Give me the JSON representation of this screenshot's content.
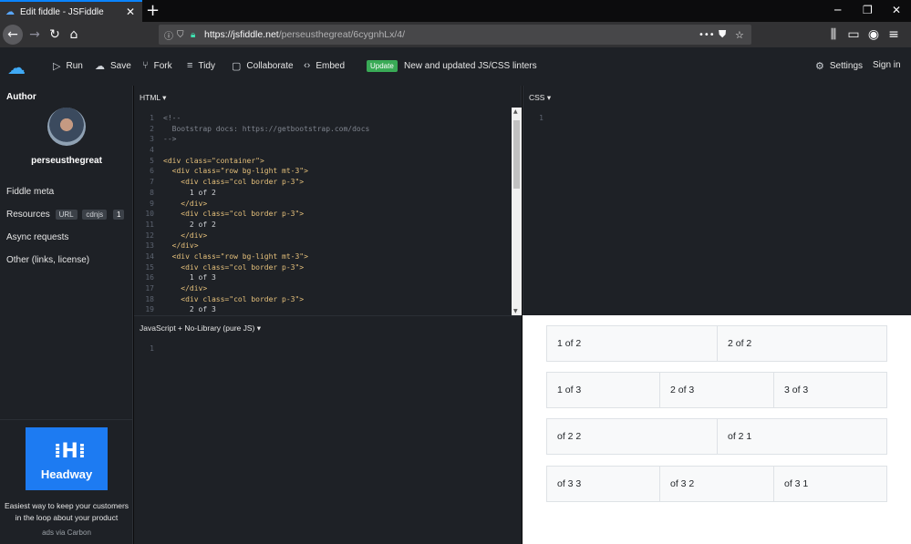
{
  "browser": {
    "tab_title": "Edit fiddle - JSFiddle",
    "url_host": "https://jsfiddle.net",
    "url_path": "/perseusthegreat/6cygnhLx/4/"
  },
  "toolbar": {
    "run": "Run",
    "save": "Save",
    "fork": "Fork",
    "tidy": "Tidy",
    "collaborate": "Collaborate",
    "embed": "Embed",
    "update_badge": "Update",
    "update_text": "New and updated JS/CSS linters",
    "settings": "Settings",
    "signin": "Sign in"
  },
  "sidebar": {
    "author_heading": "Author",
    "username": "perseusthegreat",
    "fiddle_meta": "Fiddle meta",
    "resources": "Resources",
    "url_pill": "URL",
    "cdnjs_pill": "cdnjs",
    "resources_count": "1",
    "async": "Async requests",
    "other": "Other (links, license)"
  },
  "ad": {
    "brand": "Headway",
    "copy": "Easiest way to keep your customers in the loop about your product",
    "via": "ads via Carbon"
  },
  "panes": {
    "html_label": "HTML ▾",
    "css_label": "CSS ▾",
    "js_label": "JavaScript + No-Library (pure JS) ▾"
  },
  "html_code": [
    {
      "n": "1",
      "t": "<!--",
      "k": "c"
    },
    {
      "n": "2",
      "t": "  Bootstrap docs: https://getbootstrap.com/docs",
      "k": "c"
    },
    {
      "n": "3",
      "t": "-->",
      "k": "c"
    },
    {
      "n": "4",
      "t": "",
      "k": "p"
    },
    {
      "n": "5",
      "t": "<div class=\"container\">",
      "k": "t"
    },
    {
      "n": "6",
      "t": "  <div class=\"row bg-light mt-3\">",
      "k": "t"
    },
    {
      "n": "7",
      "t": "    <div class=\"col border p-3\">",
      "k": "t"
    },
    {
      "n": "8",
      "t": "      1 of 2",
      "k": "p"
    },
    {
      "n": "9",
      "t": "    </div>",
      "k": "t"
    },
    {
      "n": "10",
      "t": "    <div class=\"col border p-3\">",
      "k": "t"
    },
    {
      "n": "11",
      "t": "      2 of 2",
      "k": "p"
    },
    {
      "n": "12",
      "t": "    </div>",
      "k": "t"
    },
    {
      "n": "13",
      "t": "  </div>",
      "k": "t"
    },
    {
      "n": "14",
      "t": "  <div class=\"row bg-light mt-3\">",
      "k": "t"
    },
    {
      "n": "15",
      "t": "    <div class=\"col border p-3\">",
      "k": "t"
    },
    {
      "n": "16",
      "t": "      1 of 3",
      "k": "p"
    },
    {
      "n": "17",
      "t": "    </div>",
      "k": "t"
    },
    {
      "n": "18",
      "t": "    <div class=\"col border p-3\">",
      "k": "t"
    },
    {
      "n": "19",
      "t": "      2 of 3",
      "k": "p"
    }
  ],
  "css_first_line": "1",
  "js_first_line": "1",
  "result_rows": [
    [
      "1 of 2",
      "2 of 2"
    ],
    [
      "1 of 3",
      "2 of 3",
      "3 of 3"
    ],
    [
      "of 2 2",
      "of 2 1"
    ],
    [
      "of 3 3",
      "of 3 2",
      "of 3 1"
    ]
  ]
}
